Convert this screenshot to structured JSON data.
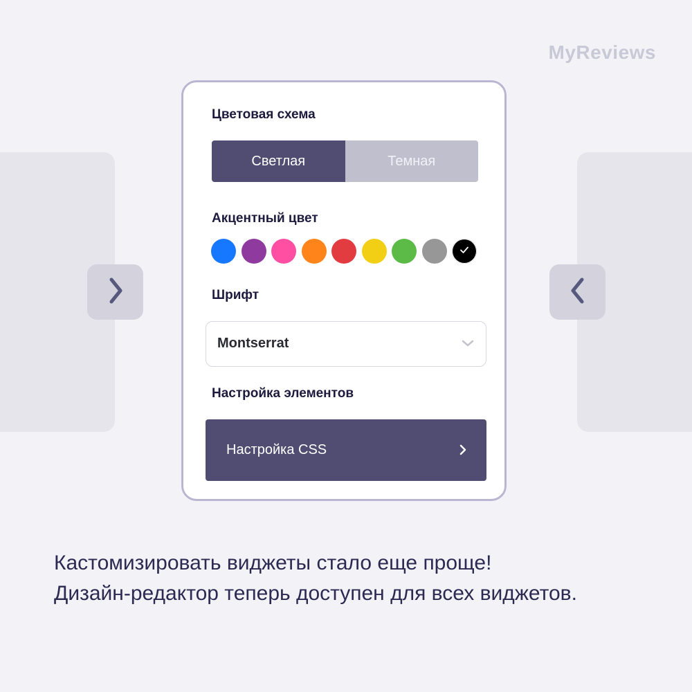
{
  "brand": "MyReviews",
  "panel": {
    "color_scheme": {
      "label": "Цветовая схема",
      "options": [
        "Светлая",
        "Темная"
      ],
      "selected": "Светлая"
    },
    "accent": {
      "label": "Акцентный цвет",
      "colors": [
        "#1677ff",
        "#8e3a9f",
        "#ff4fa3",
        "#ff8419",
        "#e23b40",
        "#f2cf15",
        "#5cba47",
        "#979797",
        "#000000"
      ],
      "selected_index": 8
    },
    "font": {
      "label": "Шрифт",
      "value": "Montserrat"
    },
    "elements": {
      "label": "Настройка элементов",
      "button_label": "Настройка CSS"
    }
  },
  "caption": {
    "line1": "Кастомизировать виджеты стало еще проще!",
    "line2": "Дизайн-редактор теперь доступен для всех виджетов."
  },
  "colors": {
    "accent": "#514d72",
    "background": "#f3f3f7",
    "panel_border": "#bab6d2",
    "text": "#2c2a52"
  },
  "icons": {
    "left_nav": "chevron-right-icon",
    "right_nav": "chevron-left-icon",
    "select": "chevron-down-icon",
    "css_button": "chevron-right-icon",
    "selected_swatch": "check-icon"
  }
}
